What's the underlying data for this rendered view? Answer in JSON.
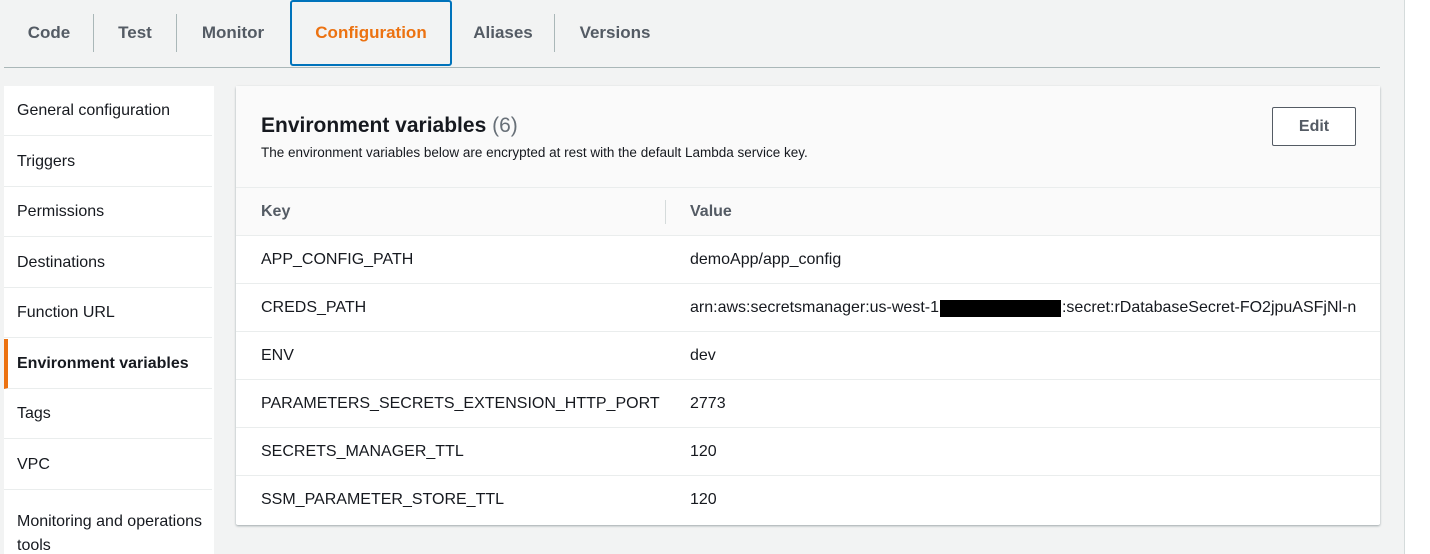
{
  "tabs": [
    {
      "label": "Code"
    },
    {
      "label": "Test"
    },
    {
      "label": "Monitor"
    },
    {
      "label": "Configuration",
      "active": true
    },
    {
      "label": "Aliases"
    },
    {
      "label": "Versions"
    }
  ],
  "sidebar": {
    "items": [
      {
        "label": "General configuration"
      },
      {
        "label": "Triggers"
      },
      {
        "label": "Permissions"
      },
      {
        "label": "Destinations"
      },
      {
        "label": "Function URL"
      },
      {
        "label": "Environment variables",
        "active": true
      },
      {
        "label": "Tags"
      },
      {
        "label": "VPC"
      },
      {
        "label": "Monitoring and operations tools"
      }
    ]
  },
  "panel": {
    "title": "Environment variables",
    "count": "(6)",
    "description": "The environment variables below are encrypted at rest with the default Lambda service key.",
    "edit_label": "Edit"
  },
  "table": {
    "columns": [
      "Key",
      "Value"
    ],
    "rows": [
      {
        "key": "APP_CONFIG_PATH",
        "value": "demoApp/app_config"
      },
      {
        "key": "CREDS_PATH",
        "value_prefix": "arn:aws:secretsmanager:us-west-1",
        "value_redacted": true,
        "value_suffix": ":secret:rDatabaseSecret-FO2jpuASFjNl-n"
      },
      {
        "key": "ENV",
        "value": "dev"
      },
      {
        "key": "PARAMETERS_SECRETS_EXTENSION_HTTP_PORT",
        "value": "2773"
      },
      {
        "key": "SECRETS_MANAGER_TTL",
        "value": "120"
      },
      {
        "key": "SSM_PARAMETER_STORE_TTL",
        "value": "120"
      }
    ]
  },
  "colors": {
    "accent": "#ec7211",
    "active_tab_border": "#0073bb",
    "background": "#f2f3f3"
  }
}
